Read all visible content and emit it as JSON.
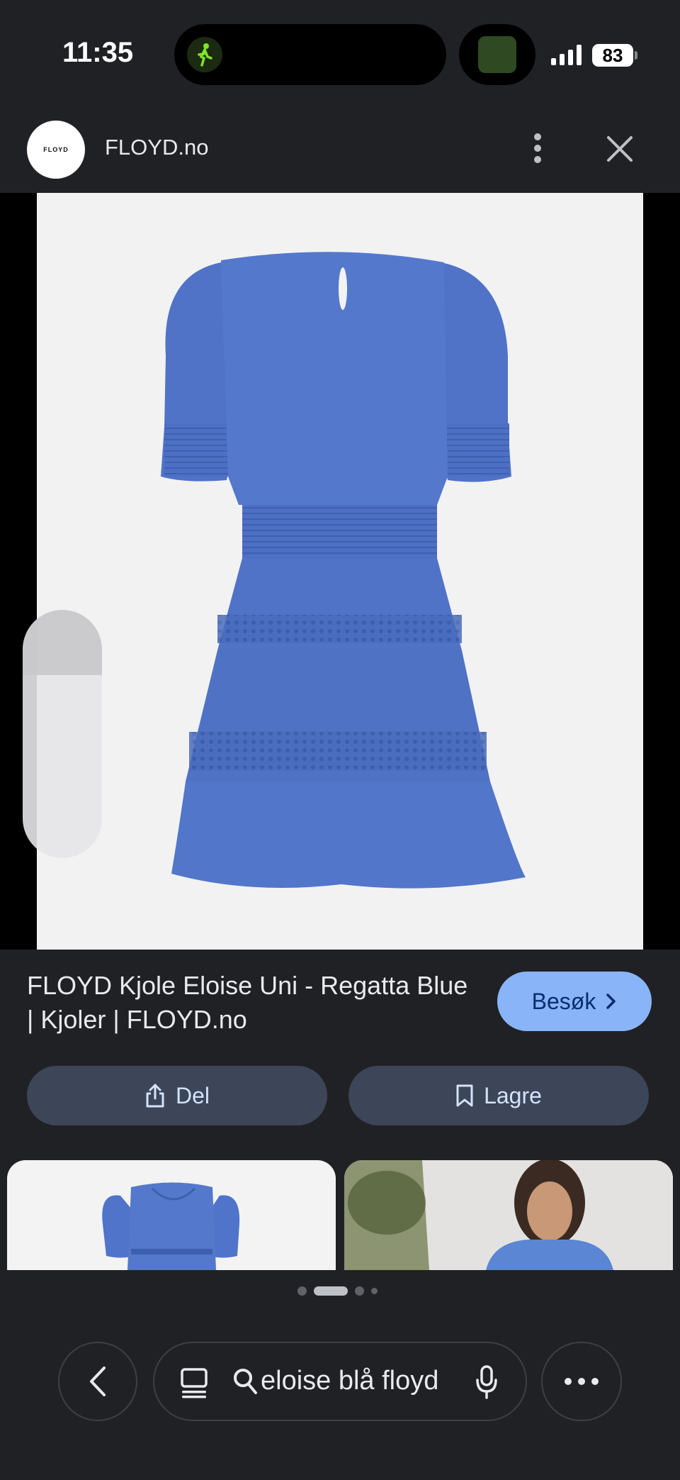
{
  "status_bar": {
    "time": "11:35",
    "battery": "83"
  },
  "header": {
    "site_name": "FLOYD.no",
    "logo_text": "FLOYD"
  },
  "result": {
    "title": "FLOYD Kjole Eloise Uni - Regatta Blue | Kjoler | FLOYD.no",
    "visit_label": "Besøk"
  },
  "actions": {
    "share_label": "Del",
    "save_label": "Lagre"
  },
  "search": {
    "query": "eloise blå floyd"
  },
  "icons": {
    "close": "close-icon",
    "more": "more-vert-icon",
    "lens": "google-lens-icon",
    "share": "share-icon",
    "bookmark": "bookmark-icon",
    "back": "chevron-left-icon",
    "tabs": "tabs-icon",
    "search": "search-icon",
    "mic": "mic-icon",
    "menu": "more-horiz-icon"
  },
  "colors": {
    "background": "#202124",
    "accent": "#8ab4f8",
    "dress": "#4e72c6"
  },
  "pagination": {
    "active_index": 1,
    "count": 4
  }
}
